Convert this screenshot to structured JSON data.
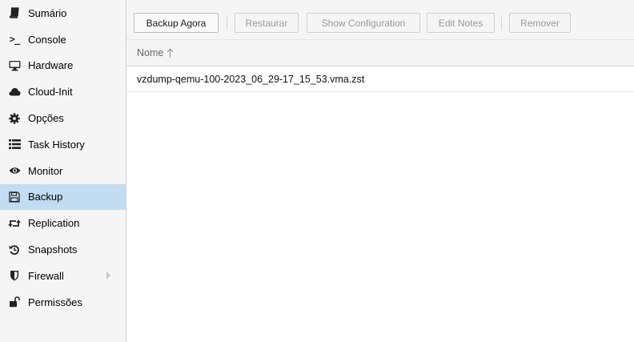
{
  "sidebar": {
    "items": [
      {
        "label": "Sumário",
        "icon": "book-icon"
      },
      {
        "label": "Console",
        "icon": "terminal-icon"
      },
      {
        "label": "Hardware",
        "icon": "desktop-icon"
      },
      {
        "label": "Cloud-Init",
        "icon": "cloud-icon"
      },
      {
        "label": "Opções",
        "icon": "gear-icon"
      },
      {
        "label": "Task History",
        "icon": "list-icon"
      },
      {
        "label": "Monitor",
        "icon": "eye-icon"
      },
      {
        "label": "Backup",
        "icon": "floppy-icon",
        "selected": true
      },
      {
        "label": "Replication",
        "icon": "retweet-icon"
      },
      {
        "label": "Snapshots",
        "icon": "history-icon"
      },
      {
        "label": "Firewall",
        "icon": "shield-icon",
        "expandable": true
      },
      {
        "label": "Permissões",
        "icon": "unlock-icon"
      }
    ],
    "console_glyph": ">_"
  },
  "toolbar": {
    "backup_now_label": "Backup Agora",
    "restore_label": "Restaurar",
    "show_config_label": "Show Configuration",
    "edit_notes_label": "Edit Notes",
    "remove_label": "Remover"
  },
  "grid": {
    "column_name": "Nome",
    "sort_direction": "ascending",
    "rows": [
      {
        "name": "vzdump-qemu-100-2023_06_29-17_15_53.vma.zst"
      }
    ]
  },
  "colors": {
    "selected_bg": "#c2ddf2",
    "sidebar_bg": "#f5f5f5",
    "disabled_text": "#9a9a9a"
  }
}
